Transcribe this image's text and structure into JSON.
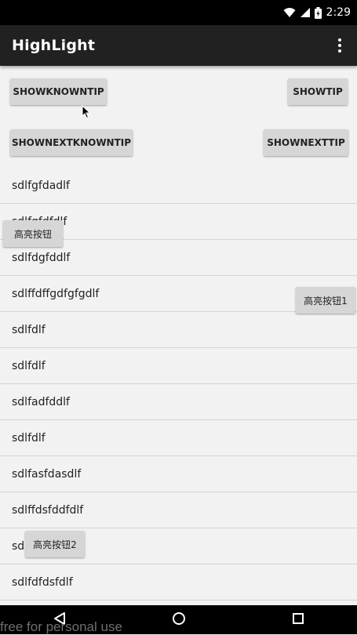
{
  "status_bar": {
    "time": "2:29",
    "icons": [
      "wifi-icon",
      "signal-icon",
      "battery-icon"
    ]
  },
  "toolbar": {
    "title": "HighLight",
    "overflow_icon": "more-vert-icon"
  },
  "buttons": {
    "show_known_tip": "SHOWKNOWNTIP",
    "show_tip": "SHOWTIP",
    "show_next_known_tip": "SHOWNEXTKNOWNTIP",
    "show_next_tip": "SHOWNEXTTIP",
    "highlight_button": "高亮按钮",
    "highlight_button_1": "高亮按钮1",
    "highlight_button_2": "高亮按钮2"
  },
  "list_items": [
    "sdlfgfdadlf",
    "sdlfgfdfdlf",
    "sdlfdgfddlf",
    "sdlffdffgdfgfgdlf",
    "sdlfdlf",
    "sdlfdlf",
    "sdlfadfddlf",
    "sdlfdlf",
    "sdlfasfdasdlf",
    "sdlffdsfddfdlf",
    "sdlfdlf",
    "sdlfdfdsfdlf"
  ],
  "nav_bar": {
    "back_icon": "back-icon",
    "home_icon": "home-icon",
    "recents_icon": "recents-icon"
  },
  "watermark": "free for personal use",
  "colors": {
    "status_bar": "#000000",
    "toolbar": "#212121",
    "background": "#f2f2f2",
    "button": "#d6d6d6"
  }
}
